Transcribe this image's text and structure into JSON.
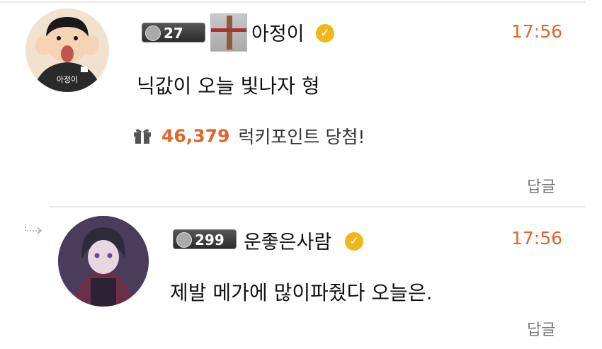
{
  "comments": [
    {
      "level_badge": "27",
      "nickname": "아정이",
      "avatar_text": "아정이",
      "time": "17:56",
      "message": "닉값이 오늘 빛나자 형",
      "lucky": {
        "points": "46,379",
        "text": "럭키포인트 당첨!"
      },
      "reply_label": "답글"
    },
    {
      "level_badge": "299",
      "nickname": "운좋은사람",
      "time": "17:56",
      "message": "제발 메가에 많이파줬다 오늘은.",
      "reply_label": "답글"
    }
  ],
  "colors": {
    "accent": "#e0652b",
    "verified": "#f0b61e",
    "divider": "#e6e6e6"
  },
  "icons": [
    "verified-icon",
    "gift-icon",
    "reply-arrow-icon"
  ]
}
